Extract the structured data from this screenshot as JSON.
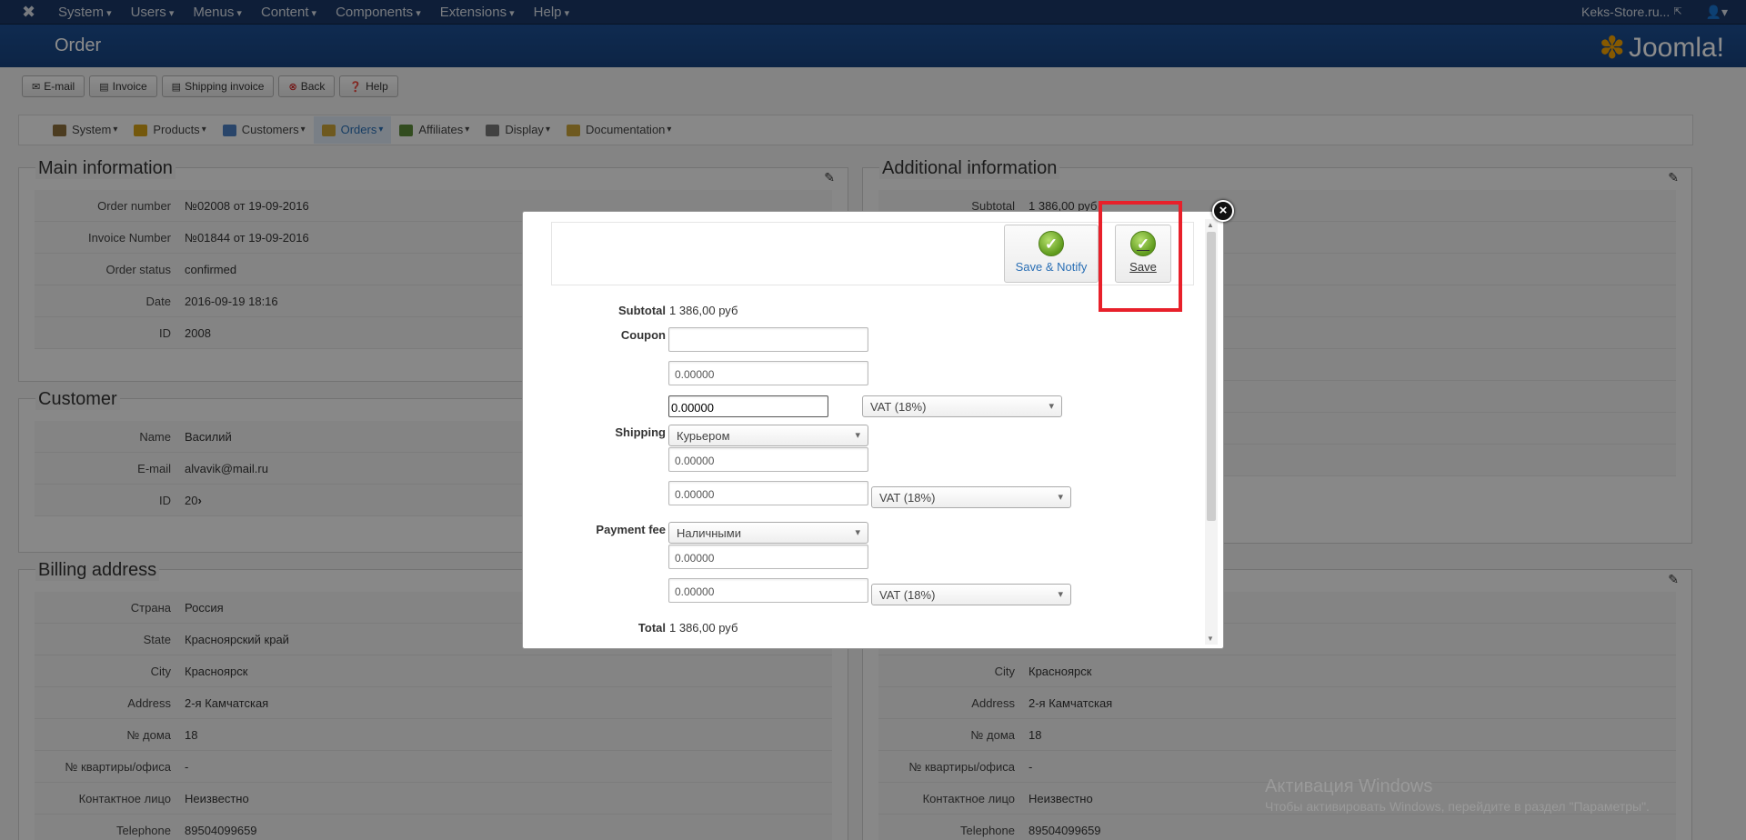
{
  "topnav": {
    "menu": [
      "System",
      "Users",
      "Menus",
      "Content",
      "Components",
      "Extensions",
      "Help"
    ],
    "site_link": "Keks-Store.ru...",
    "user_icon": "user-icon"
  },
  "header": {
    "title": "Order",
    "brand": "Joomla!"
  },
  "toolbar": {
    "email": "E-mail",
    "invoice": "Invoice",
    "shipping_invoice": "Shipping invoice",
    "back": "Back",
    "help": "Help"
  },
  "subnav": [
    {
      "label": "System",
      "icon": "wrench-icon",
      "color": "#8a6d3b"
    },
    {
      "label": "Products",
      "icon": "box-icon",
      "color": "#d4a017"
    },
    {
      "label": "Customers",
      "icon": "users-icon",
      "color": "#4b7fc1"
    },
    {
      "label": "Orders",
      "icon": "orders-icon",
      "color": "#c9a33a"
    },
    {
      "label": "Affiliates",
      "icon": "affiliates-icon",
      "color": "#5b8a3a"
    },
    {
      "label": "Display",
      "icon": "display-icon",
      "color": "#777777"
    },
    {
      "label": "Documentation",
      "icon": "docs-icon",
      "color": "#c9a33a"
    }
  ],
  "main_info": {
    "title": "Main information",
    "rows": [
      {
        "label": "Order number",
        "value": "№02008 от 19-09-2016"
      },
      {
        "label": "Invoice Number",
        "value": "№01844 от 19-09-2016"
      },
      {
        "label": "Order status",
        "value": "confirmed"
      },
      {
        "label": "Date",
        "value": "2016-09-19 18:16"
      },
      {
        "label": "ID",
        "value": "2008"
      }
    ]
  },
  "customer": {
    "title": "Customer",
    "rows": [
      {
        "label": "Name",
        "value": "Василий"
      },
      {
        "label": "E-mail",
        "value": "alvavik@mail.ru"
      },
      {
        "label": "ID",
        "value": "20"
      }
    ]
  },
  "billing": {
    "title": "Billing address",
    "rows": [
      {
        "label": "Страна",
        "value": "Россия"
      },
      {
        "label": "State",
        "value": "Красноярский край"
      },
      {
        "label": "City",
        "value": "Красноярск"
      },
      {
        "label": "Address",
        "value": "2-я Камчатская"
      },
      {
        "label": "№ дома",
        "value": "18"
      },
      {
        "label": "№ квартиры/офиса",
        "value": "-"
      },
      {
        "label": "Контактное лицо",
        "value": "Неизвестно"
      },
      {
        "label": "Telephone",
        "value": "89504099659"
      }
    ]
  },
  "additional": {
    "title": "Additional information",
    "rows": [
      {
        "label": "Subtotal",
        "value": "1 386,00 руб"
      }
    ]
  },
  "shipping_address": {
    "rows": [
      {
        "label": "City",
        "value": "Красноярск"
      },
      {
        "label": "Address",
        "value": "2-я Камчатская"
      },
      {
        "label": "№ дома",
        "value": "18"
      },
      {
        "label": "№ квартиры/офиса",
        "value": "-"
      },
      {
        "label": "Контактное лицо",
        "value": "Неизвестно"
      },
      {
        "label": "Telephone",
        "value": "89504099659"
      }
    ]
  },
  "modal": {
    "save_notify": "Save & Notify",
    "save": "Save",
    "subtotal_label": "Subtotal",
    "subtotal_value": "1 386,00 руб",
    "coupon_label": "Coupon",
    "coupon_value": "",
    "coupon_amount": "0.00000",
    "coupon_tax_amount": "0.00000",
    "coupon_tax": "VAT (18%)",
    "shipping_label": "Shipping",
    "shipping_method": "Курьером",
    "shipping_amount": "0.00000",
    "shipping_tax_amount": "0.00000",
    "shipping_tax": "VAT (18%)",
    "payment_label": "Payment fee",
    "payment_method": "Наличными",
    "payment_amount": "0.00000",
    "payment_tax_amount": "0.00000",
    "payment_tax": "VAT (18%)",
    "total_label": "Total",
    "total_value": "1 386,00 руб"
  },
  "watermark": {
    "line1": "Активация Windows",
    "line2": "Чтобы активировать Windows, перейдите в раздел \"Параметры\"."
  }
}
